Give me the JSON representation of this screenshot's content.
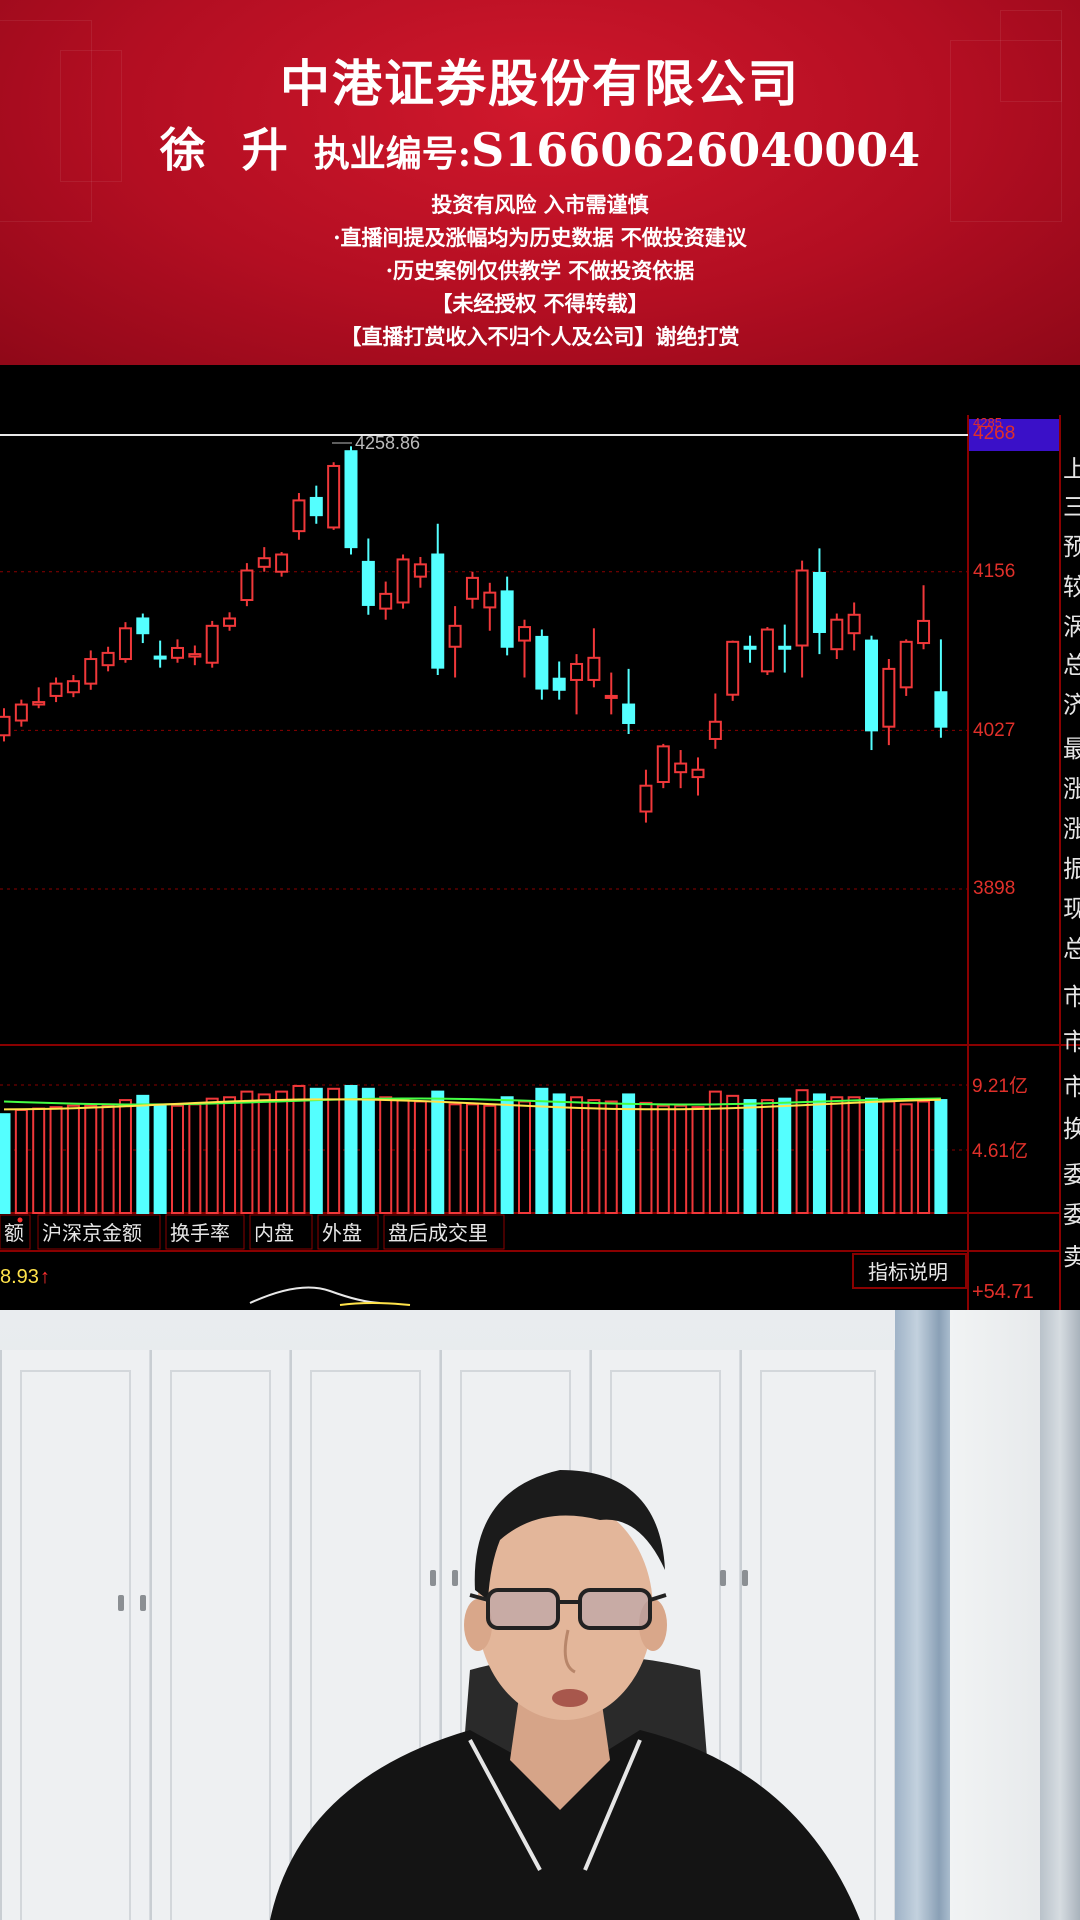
{
  "banner": {
    "company": "中港证券股份有限公司",
    "host_name": "徐 升",
    "license_label": "执业编号:",
    "license_number": "S1660626040004",
    "disclaimers": [
      "投资有风险 入市需谨慎",
      "·直播间提及涨幅均为历史数据  不做投资建议",
      "·历史案例仅供教学  不做投资依据",
      "【未经授权 不得转载】",
      "【直播打赏收入不归个人及公司】谢绝打赏"
    ],
    "colors": {
      "background": "#c4122a",
      "text": "#ffffff"
    }
  },
  "chart_data": {
    "type": "candlestick",
    "price_axis": {
      "labels": [
        "4268",
        "4156",
        "4027",
        "3898"
      ],
      "highlight": "4268"
    },
    "high_marker": "4258.86",
    "candles": [
      {
        "o": 4023,
        "c": 4038,
        "h": 4045,
        "l": 4018,
        "up": true
      },
      {
        "o": 4035,
        "c": 4048,
        "h": 4052,
        "l": 4030,
        "up": true
      },
      {
        "o": 4048,
        "c": 4050,
        "h": 4062,
        "l": 4045,
        "up": true
      },
      {
        "o": 4055,
        "c": 4065,
        "h": 4070,
        "l": 4050,
        "up": true
      },
      {
        "o": 4058,
        "c": 4067,
        "h": 4072,
        "l": 4054,
        "up": true
      },
      {
        "o": 4065,
        "c": 4085,
        "h": 4092,
        "l": 4060,
        "up": true
      },
      {
        "o": 4080,
        "c": 4090,
        "h": 4095,
        "l": 4075,
        "up": true
      },
      {
        "o": 4085,
        "c": 4110,
        "h": 4115,
        "l": 4082,
        "up": true
      },
      {
        "o": 4118,
        "c": 4106,
        "h": 4122,
        "l": 4098,
        "up": false
      },
      {
        "o": 4087,
        "c": 4087,
        "h": 4100,
        "l": 4078,
        "up": false
      },
      {
        "o": 4086,
        "c": 4094,
        "h": 4101,
        "l": 4082,
        "up": true
      },
      {
        "o": 4087,
        "c": 4089,
        "h": 4096,
        "l": 4080,
        "up": true
      },
      {
        "o": 4082,
        "c": 4112,
        "h": 4116,
        "l": 4078,
        "up": true
      },
      {
        "o": 4112,
        "c": 4118,
        "h": 4123,
        "l": 4108,
        "up": true
      },
      {
        "o": 4133,
        "c": 4157,
        "h": 4163,
        "l": 4128,
        "up": true
      },
      {
        "o": 4160,
        "c": 4167,
        "h": 4176,
        "l": 4156,
        "up": true
      },
      {
        "o": 4156,
        "c": 4170,
        "h": 4172,
        "l": 4152,
        "up": true
      },
      {
        "o": 4189,
        "c": 4214,
        "h": 4220,
        "l": 4182,
        "up": true
      },
      {
        "o": 4216,
        "c": 4202,
        "h": 4226,
        "l": 4195,
        "up": false
      },
      {
        "o": 4192,
        "c": 4242,
        "h": 4245,
        "l": 4190,
        "up": true
      },
      {
        "o": 4254,
        "c": 4176,
        "h": 4258,
        "l": 4170,
        "up": false
      },
      {
        "o": 4164,
        "c": 4129,
        "h": 4183,
        "l": 4121,
        "up": false
      },
      {
        "o": 4126,
        "c": 4138,
        "h": 4148,
        "l": 4117,
        "up": true
      },
      {
        "o": 4131,
        "c": 4166,
        "h": 4170,
        "l": 4126,
        "up": true
      },
      {
        "o": 4152,
        "c": 4162,
        "h": 4168,
        "l": 4143,
        "up": true
      },
      {
        "o": 4170,
        "c": 4078,
        "h": 4195,
        "l": 4072,
        "up": false
      },
      {
        "o": 4095,
        "c": 4112,
        "h": 4128,
        "l": 4070,
        "up": true
      },
      {
        "o": 4134,
        "c": 4151,
        "h": 4156,
        "l": 4126,
        "up": true
      },
      {
        "o": 4127,
        "c": 4139,
        "h": 4147,
        "l": 4108,
        "up": true
      },
      {
        "o": 4140,
        "c": 4095,
        "h": 4152,
        "l": 4088,
        "up": false
      },
      {
        "o": 4100,
        "c": 4111,
        "h": 4117,
        "l": 4070,
        "up": true
      },
      {
        "o": 4103,
        "c": 4061,
        "h": 4109,
        "l": 4052,
        "up": false
      },
      {
        "o": 4069,
        "c": 4060,
        "h": 4083,
        "l": 4052,
        "up": false
      },
      {
        "o": 4068,
        "c": 4081,
        "h": 4089,
        "l": 4040,
        "up": true
      },
      {
        "o": 4068,
        "c": 4086,
        "h": 4110,
        "l": 4062,
        "up": true
      },
      {
        "o": 4055,
        "c": 4055,
        "h": 4074,
        "l": 4040,
        "up": true
      },
      {
        "o": 4048,
        "c": 4033,
        "h": 4077,
        "l": 4024,
        "up": false
      },
      {
        "o": 3961,
        "c": 3982,
        "h": 3995,
        "l": 3952,
        "up": true
      },
      {
        "o": 3985,
        "c": 4014,
        "h": 4016,
        "l": 3980,
        "up": true
      },
      {
        "o": 3993,
        "c": 4000,
        "h": 4011,
        "l": 3980,
        "up": true
      },
      {
        "o": 3989,
        "c": 3995,
        "h": 4005,
        "l": 3974,
        "up": true
      },
      {
        "o": 4020,
        "c": 4034,
        "h": 4057,
        "l": 4012,
        "up": true
      },
      {
        "o": 4056,
        "c": 4099,
        "h": 4100,
        "l": 4051,
        "up": true
      },
      {
        "o": 4094,
        "c": 4095,
        "h": 4104,
        "l": 4082,
        "up": false
      },
      {
        "o": 4075,
        "c": 4109,
        "h": 4111,
        "l": 4072,
        "up": true
      },
      {
        "o": 4095,
        "c": 4095,
        "h": 4113,
        "l": 4074,
        "up": false
      },
      {
        "o": 4096,
        "c": 4157,
        "h": 4165,
        "l": 4070,
        "up": true
      },
      {
        "o": 4155,
        "c": 4107,
        "h": 4175,
        "l": 4089,
        "up": false
      },
      {
        "o": 4093,
        "c": 4117,
        "h": 4122,
        "l": 4085,
        "up": true
      },
      {
        "o": 4106,
        "c": 4121,
        "h": 4131,
        "l": 4092,
        "up": true
      },
      {
        "o": 4100,
        "c": 4027,
        "h": 4104,
        "l": 4011,
        "up": false
      },
      {
        "o": 4030,
        "c": 4077,
        "h": 4085,
        "l": 4015,
        "up": true
      },
      {
        "o": 4062,
        "c": 4099,
        "h": 4101,
        "l": 4055,
        "up": true
      },
      {
        "o": 4098,
        "c": 4116,
        "h": 4145,
        "l": 4093,
        "up": true
      },
      {
        "o": 4058,
        "c": 4030,
        "h": 4101,
        "l": 4021,
        "up": false
      }
    ],
    "volume_axis": [
      "9.21亿",
      "4.61亿"
    ],
    "volume_bars": [
      {
        "v": 7.0,
        "up": false
      },
      {
        "v": 7.3,
        "up": true
      },
      {
        "v": 7.4,
        "up": true
      },
      {
        "v": 7.5,
        "up": true
      },
      {
        "v": 7.6,
        "up": true
      },
      {
        "v": 7.6,
        "up": true
      },
      {
        "v": 7.6,
        "up": true
      },
      {
        "v": 8.0,
        "up": true
      },
      {
        "v": 8.3,
        "up": false
      },
      {
        "v": 7.6,
        "up": false
      },
      {
        "v": 7.6,
        "up": true
      },
      {
        "v": 7.7,
        "up": true
      },
      {
        "v": 8.1,
        "up": true
      },
      {
        "v": 8.2,
        "up": true
      },
      {
        "v": 8.6,
        "up": true
      },
      {
        "v": 8.4,
        "up": true
      },
      {
        "v": 8.6,
        "up": true
      },
      {
        "v": 9.0,
        "up": true
      },
      {
        "v": 8.8,
        "up": false
      },
      {
        "v": 8.8,
        "up": true
      },
      {
        "v": 9.0,
        "up": false
      },
      {
        "v": 8.8,
        "up": false
      },
      {
        "v": 8.2,
        "up": true
      },
      {
        "v": 8.0,
        "up": true
      },
      {
        "v": 7.9,
        "up": true
      },
      {
        "v": 8.6,
        "up": false
      },
      {
        "v": 7.7,
        "up": true
      },
      {
        "v": 7.7,
        "up": true
      },
      {
        "v": 7.6,
        "up": true
      },
      {
        "v": 8.2,
        "up": false
      },
      {
        "v": 7.9,
        "up": true
      },
      {
        "v": 8.8,
        "up": false
      },
      {
        "v": 8.4,
        "up": false
      },
      {
        "v": 8.2,
        "up": true
      },
      {
        "v": 8.0,
        "up": true
      },
      {
        "v": 7.9,
        "up": true
      },
      {
        "v": 8.4,
        "up": false
      },
      {
        "v": 7.8,
        "up": true
      },
      {
        "v": 7.6,
        "up": true
      },
      {
        "v": 7.6,
        "up": true
      },
      {
        "v": 7.5,
        "up": true
      },
      {
        "v": 8.6,
        "up": true
      },
      {
        "v": 8.3,
        "up": true
      },
      {
        "v": 8.0,
        "up": false
      },
      {
        "v": 8.0,
        "up": true
      },
      {
        "v": 8.1,
        "up": false
      },
      {
        "v": 8.7,
        "up": true
      },
      {
        "v": 8.4,
        "up": false
      },
      {
        "v": 8.2,
        "up": true
      },
      {
        "v": 8.2,
        "up": true
      },
      {
        "v": 8.1,
        "up": false
      },
      {
        "v": 7.9,
        "up": true
      },
      {
        "v": 7.7,
        "up": true
      },
      {
        "v": 7.9,
        "up": true
      },
      {
        "v": 8.0,
        "up": false
      }
    ],
    "indicator_tabs": [
      "额",
      "沪深京金额",
      "换手率",
      "内盘",
      "外盘",
      "盘后成交里"
    ],
    "indicator_value": "8.93",
    "indicator_arrow": "↑",
    "indicator_help": "指标说明",
    "indicator_right_value": "+54.71",
    "sidebar_chars": [
      "上",
      "三",
      "预",
      "较",
      "涡",
      "总",
      "济",
      "最",
      "涨",
      "涨",
      "振",
      "现",
      "总",
      "市",
      "市",
      "市",
      "换",
      "委",
      "委",
      "卖"
    ],
    "colors": {
      "up": "#f0383a",
      "down": "#54ffff",
      "grid": "#8a0000",
      "axis_label": "#e0302a",
      "highlight_box": "#3a10c8",
      "ma_yellow": "#ffe34a",
      "ma_green": "#44ff44"
    }
  },
  "video": {
    "scene": "presenter-webcam"
  }
}
